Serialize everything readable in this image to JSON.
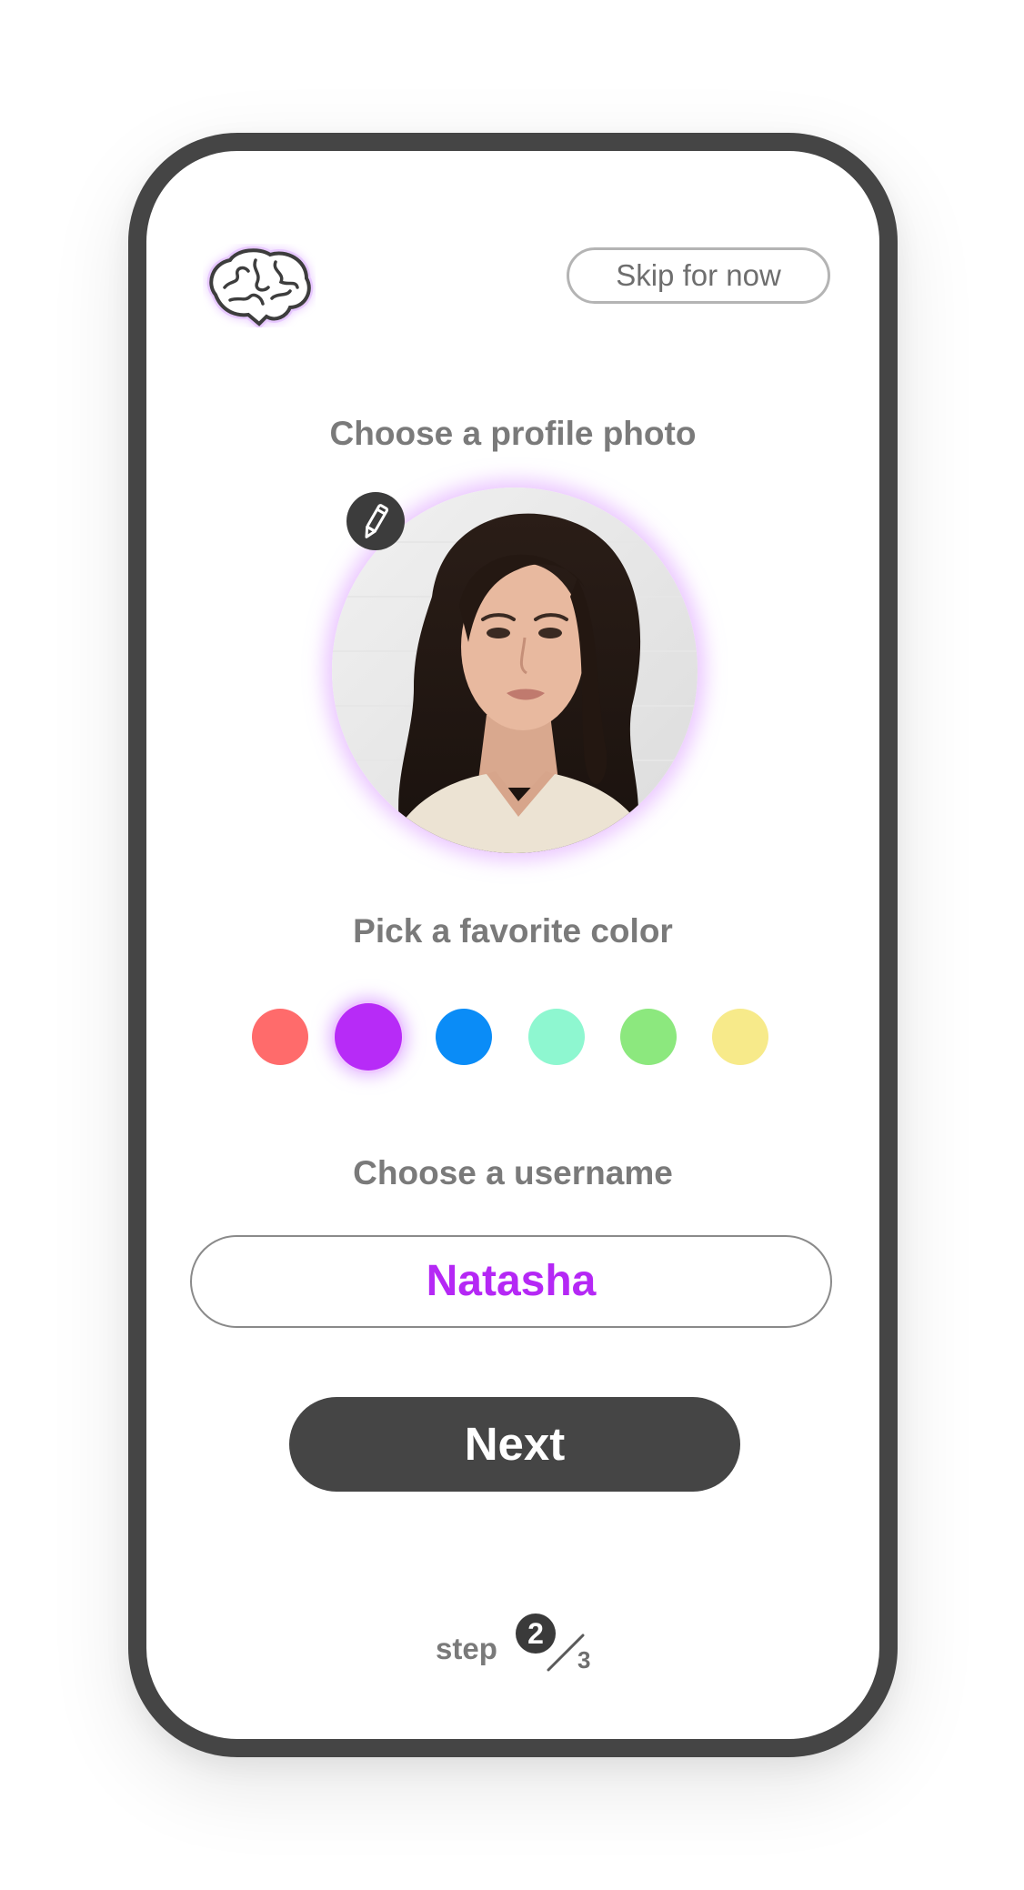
{
  "header": {
    "logo_icon": "brain-icon",
    "skip_label": "Skip for now"
  },
  "profile_photo": {
    "heading": "Choose a profile photo",
    "edit_icon": "pencil-icon"
  },
  "colors": {
    "heading": "Pick a favorite color",
    "options": [
      "#ff6b6b",
      "#b72bf7",
      "#0a8cf7",
      "#8ef7d0",
      "#8ce87e",
      "#f7ea8a"
    ],
    "selected_index": 1
  },
  "username": {
    "heading": "Choose a username",
    "value": "Natasha"
  },
  "next_label": "Next",
  "step": {
    "label": "step",
    "current": "2",
    "total": "3"
  }
}
